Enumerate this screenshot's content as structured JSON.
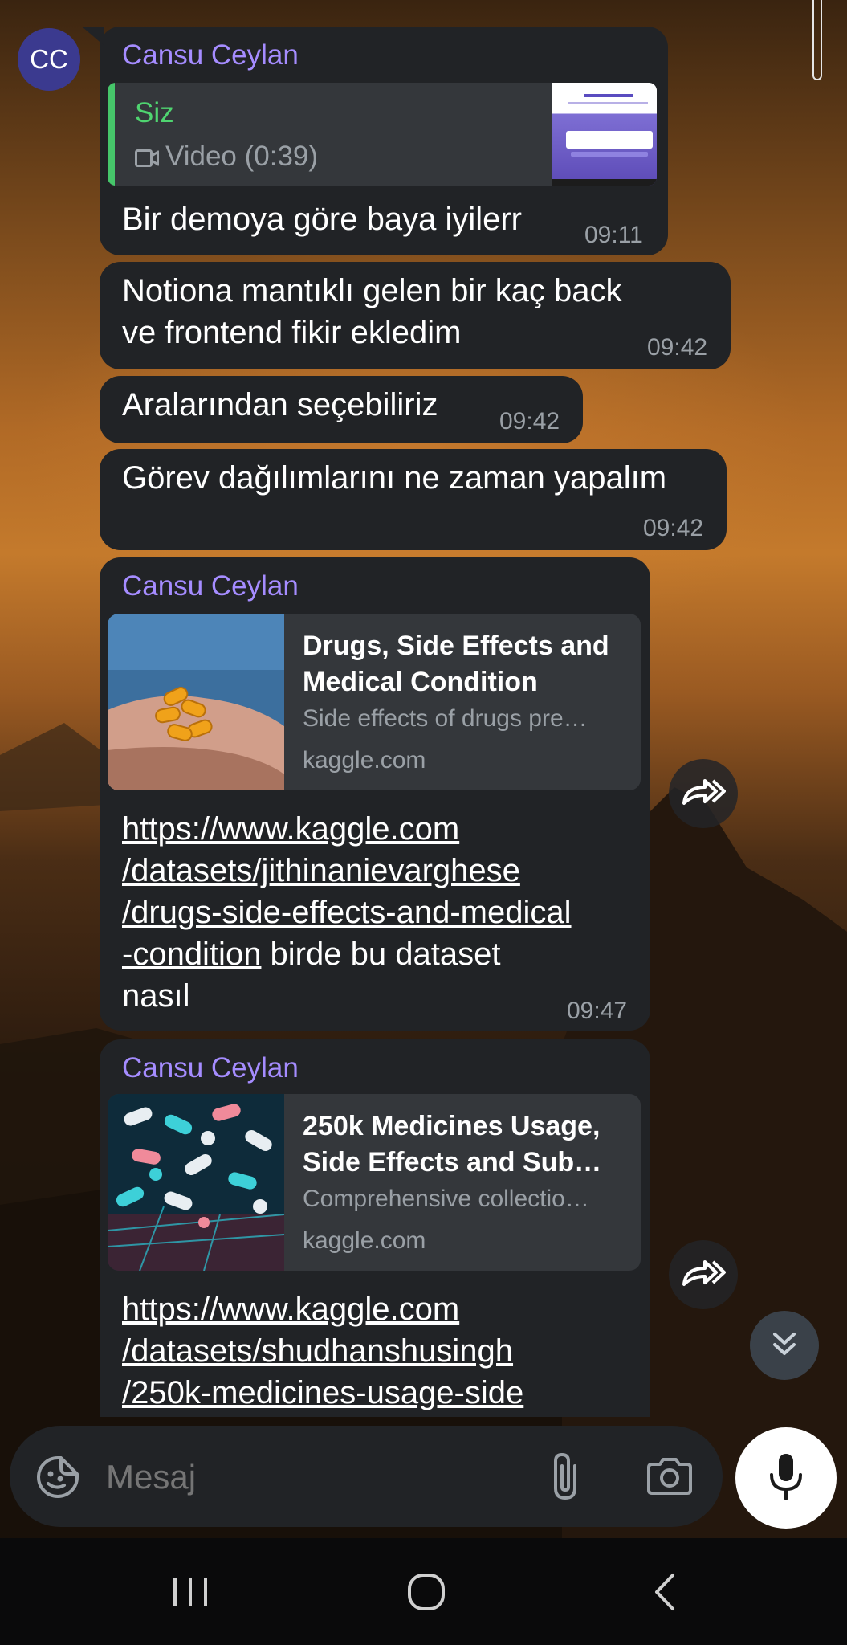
{
  "chat": {
    "avatar_initials": "CC",
    "sender_name": "Cansu Ceylan",
    "messages": [
      {
        "sender": "Cansu Ceylan",
        "reply": {
          "title": "Siz",
          "subtitle": "Video (0:39)"
        },
        "text": "Bir demoya göre baya iyilerr",
        "time": "09:11"
      },
      {
        "text_line1": "Notiona mantıklı gelen bir kaç back",
        "text_line2": "ve frontend fikir ekledim",
        "time": "09:42"
      },
      {
        "text": "Aralarından seçebiliriz",
        "time": "09:42"
      },
      {
        "text": "Görev dağılımlarını ne zaman yapalım",
        "time": "09:42"
      },
      {
        "sender": "Cansu Ceylan",
        "preview": {
          "title_line1": "Drugs, Side Effects and",
          "title_line2": "Medical Condition",
          "description": "Side effects of drugs pre…",
          "site": "kaggle.com"
        },
        "link_lines": [
          "https://www.kaggle.com",
          "/datasets/jithinanievarghese",
          "/drugs-side-effects-and-medical",
          "-condition"
        ],
        "text_after": " birde bu dataset",
        "text_last": "nasıl",
        "time": "09:47"
      },
      {
        "sender": "Cansu Ceylan",
        "preview": {
          "title_line1": "250k Medicines Usage,",
          "title_line2": "Side Effects and Sub…",
          "description": "Comprehensive collectio…",
          "site": "kaggle.com"
        },
        "link_lines": [
          "https://www.kaggle.com",
          "/datasets/shudhanshusingh",
          "/250k-medicines-usage-side"
        ]
      }
    ]
  },
  "composer": {
    "placeholder": "Mesaj"
  },
  "icons": {
    "sticker": "sticker-icon",
    "attach": "paperclip-icon",
    "camera": "camera-icon",
    "mic": "microphone-icon",
    "forward": "forward-icon",
    "scroll_down": "double-chevron-down-icon",
    "video": "video-icon"
  },
  "colors": {
    "bubble": "#212326",
    "sender_name": "#a58cff",
    "reply_accent": "#46c66a",
    "avatar": "#3b3a8f"
  }
}
